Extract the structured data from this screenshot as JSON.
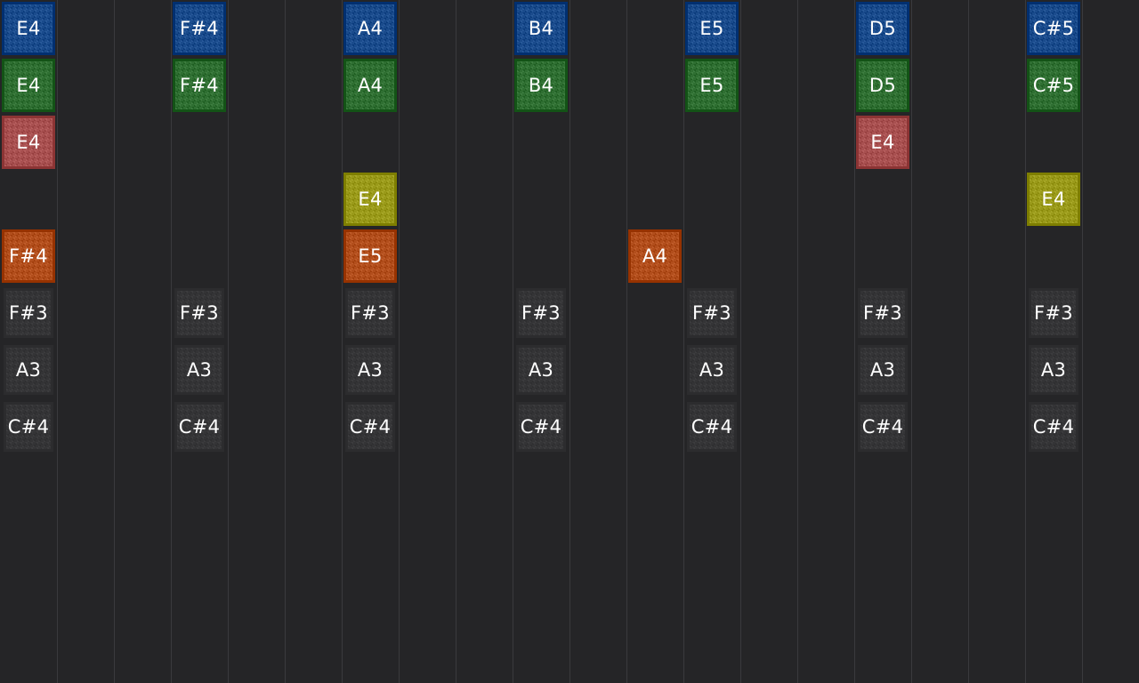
{
  "palette": {
    "background": "#252527",
    "gridline": "#3a3a3d",
    "blue": "#1a4b8c",
    "green": "#2f6f32",
    "red": "#a85050",
    "yellow": "#9a9a1a",
    "orange": "#b24e1c",
    "gray": "#343436"
  },
  "columns": [
    {
      "notes": [
        {
          "row": 0,
          "label": "E4",
          "color": "blue"
        },
        {
          "row": 1,
          "label": "E4",
          "color": "green"
        },
        {
          "row": 2,
          "label": "E4",
          "color": "red"
        },
        {
          "row": 4,
          "label": "F#4",
          "color": "orange"
        },
        {
          "row": 5,
          "label": "F#3",
          "color": "gray"
        },
        {
          "row": 6,
          "label": "A3",
          "color": "gray"
        },
        {
          "row": 7,
          "label": "C#4",
          "color": "gray"
        }
      ]
    },
    {
      "notes": []
    },
    {
      "notes": []
    },
    {
      "notes": [
        {
          "row": 0,
          "label": "F#4",
          "color": "blue"
        },
        {
          "row": 1,
          "label": "F#4",
          "color": "green"
        },
        {
          "row": 5,
          "label": "F#3",
          "color": "gray"
        },
        {
          "row": 6,
          "label": "A3",
          "color": "gray"
        },
        {
          "row": 7,
          "label": "C#4",
          "color": "gray"
        }
      ]
    },
    {
      "notes": []
    },
    {
      "notes": []
    },
    {
      "notes": [
        {
          "row": 0,
          "label": "A4",
          "color": "blue"
        },
        {
          "row": 1,
          "label": "A4",
          "color": "green"
        },
        {
          "row": 3,
          "label": "E4",
          "color": "yellow"
        },
        {
          "row": 4,
          "label": "E5",
          "color": "orange"
        },
        {
          "row": 5,
          "label": "F#3",
          "color": "gray"
        },
        {
          "row": 6,
          "label": "A3",
          "color": "gray"
        },
        {
          "row": 7,
          "label": "C#4",
          "color": "gray"
        }
      ]
    },
    {
      "notes": []
    },
    {
      "notes": []
    },
    {
      "notes": [
        {
          "row": 0,
          "label": "B4",
          "color": "blue"
        },
        {
          "row": 1,
          "label": "B4",
          "color": "green"
        },
        {
          "row": 5,
          "label": "F#3",
          "color": "gray"
        },
        {
          "row": 6,
          "label": "A3",
          "color": "gray"
        },
        {
          "row": 7,
          "label": "C#4",
          "color": "gray"
        }
      ]
    },
    {
      "notes": []
    },
    {
      "notes": [
        {
          "row": 4,
          "label": "A4",
          "color": "orange"
        }
      ]
    },
    {
      "notes": [
        {
          "row": 0,
          "label": "E5",
          "color": "blue"
        },
        {
          "row": 1,
          "label": "E5",
          "color": "green"
        },
        {
          "row": 5,
          "label": "F#3",
          "color": "gray"
        },
        {
          "row": 6,
          "label": "A3",
          "color": "gray"
        },
        {
          "row": 7,
          "label": "C#4",
          "color": "gray"
        }
      ]
    },
    {
      "notes": []
    },
    {
      "notes": []
    },
    {
      "notes": [
        {
          "row": 0,
          "label": "D5",
          "color": "blue"
        },
        {
          "row": 1,
          "label": "D5",
          "color": "green"
        },
        {
          "row": 2,
          "label": "E4",
          "color": "red"
        },
        {
          "row": 5,
          "label": "F#3",
          "color": "gray"
        },
        {
          "row": 6,
          "label": "A3",
          "color": "gray"
        },
        {
          "row": 7,
          "label": "C#4",
          "color": "gray"
        }
      ]
    },
    {
      "notes": []
    },
    {
      "notes": []
    },
    {
      "notes": [
        {
          "row": 0,
          "label": "C#5",
          "color": "blue"
        },
        {
          "row": 1,
          "label": "C#5",
          "color": "green"
        },
        {
          "row": 3,
          "label": "E4",
          "color": "yellow"
        },
        {
          "row": 5,
          "label": "F#3",
          "color": "gray"
        },
        {
          "row": 6,
          "label": "A3",
          "color": "gray"
        },
        {
          "row": 7,
          "label": "C#4",
          "color": "gray"
        }
      ]
    },
    {
      "notes": []
    }
  ]
}
